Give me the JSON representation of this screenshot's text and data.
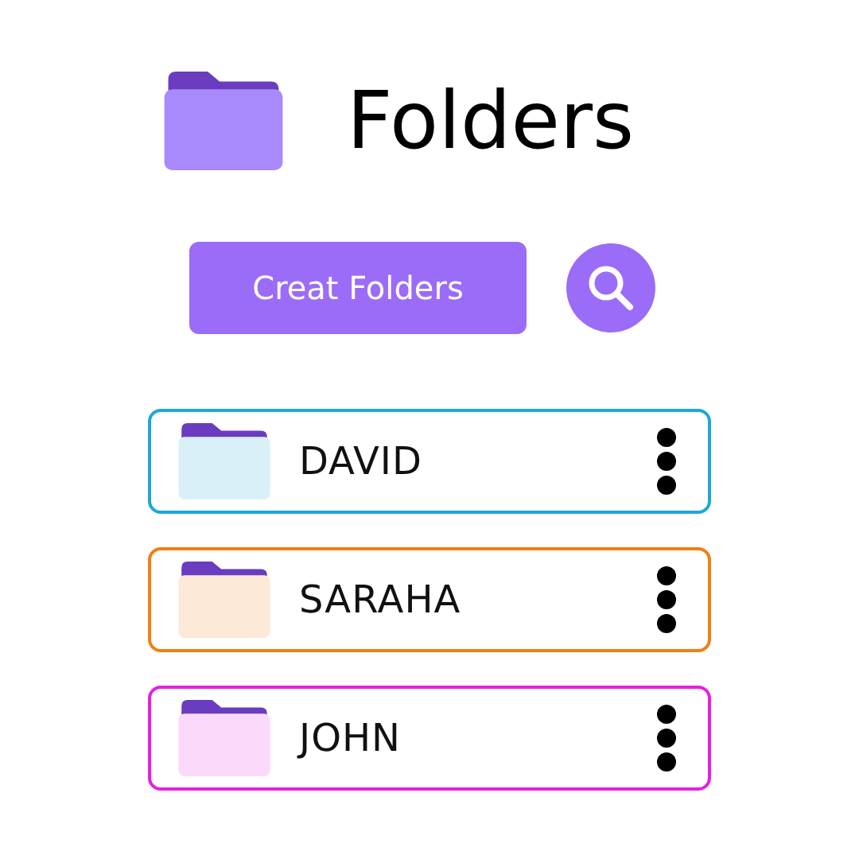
{
  "header": {
    "title": "Folders"
  },
  "actions": {
    "create_button": "Creat Folders"
  },
  "folders": [
    {
      "name": "DAVID",
      "color": "#1ea7d8"
    },
    {
      "name": "SARAHA",
      "color": "#f07f14"
    },
    {
      "name": "JOHN",
      "color": "#e81ee0"
    }
  ]
}
